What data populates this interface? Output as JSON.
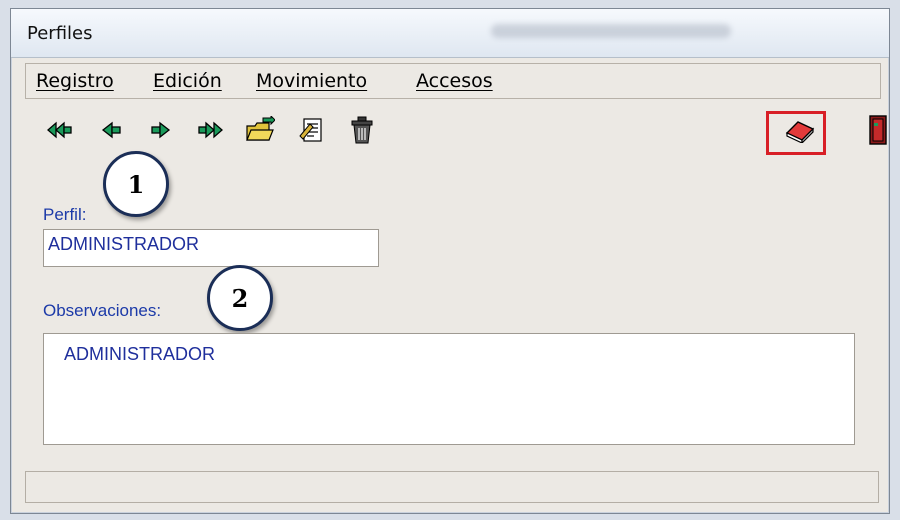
{
  "window": {
    "title": "Perfiles"
  },
  "menu": {
    "items": [
      {
        "label": "Registro"
      },
      {
        "label": "Edición"
      },
      {
        "label": "Movimiento"
      },
      {
        "label": "Accesos"
      }
    ]
  },
  "toolbar": {
    "icons": [
      "first-record-icon",
      "previous-record-icon",
      "next-record-icon",
      "last-record-icon",
      "new-folder-icon",
      "edit-document-icon",
      "trash-icon",
      "eraser-icon",
      "exit-door-icon"
    ],
    "accent_green": "#1a9a5a",
    "highlight_color": "#d81f26"
  },
  "callouts": {
    "one": "1",
    "two": "2"
  },
  "form": {
    "perfil_label": "Perfil:",
    "perfil_value": "ADMINISTRADOR",
    "observaciones_label": "Observaciones:",
    "observaciones_value": "ADMINISTRADOR"
  }
}
